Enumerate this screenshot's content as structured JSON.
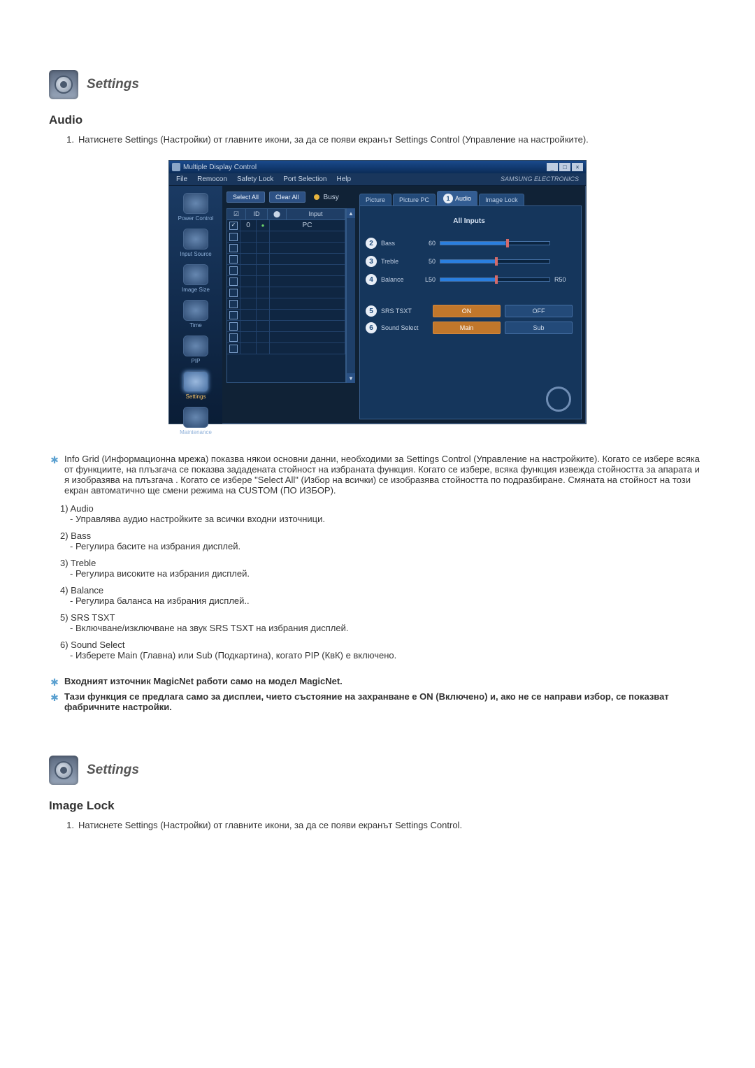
{
  "section1": {
    "title": "Settings",
    "subtitle": "Audio",
    "step_n": "1.",
    "step_text": "Натиснете Settings (Настройки) от главните икони, за да се появи екранът Settings Control (Управление на настройките)."
  },
  "app": {
    "title": "Multiple Display Control",
    "menu": [
      "File",
      "Remocon",
      "Safety Lock",
      "Port Selection",
      "Help"
    ],
    "brand": "SAMSUNG ELECTRONICS",
    "side": [
      {
        "label": "Power Control",
        "sel": false
      },
      {
        "label": "Input Source",
        "sel": false
      },
      {
        "label": "Image Size",
        "sel": false
      },
      {
        "label": "Time",
        "sel": false
      },
      {
        "label": "PIP",
        "sel": false
      },
      {
        "label": "Settings",
        "sel": true
      },
      {
        "label": "Maintenance",
        "sel": false
      }
    ],
    "grid": {
      "select_all": "Select All",
      "clear_all": "Clear All",
      "busy": "Busy",
      "headers": {
        "chk": "☑",
        "id": "ID",
        "st": "⬤",
        "input": "Input"
      },
      "rows": [
        {
          "chk": true,
          "id": "0",
          "st": "●",
          "input": "PC"
        },
        {
          "chk": false,
          "id": "",
          "st": "",
          "input": ""
        },
        {
          "chk": false,
          "id": "",
          "st": "",
          "input": ""
        },
        {
          "chk": false,
          "id": "",
          "st": "",
          "input": ""
        },
        {
          "chk": false,
          "id": "",
          "st": "",
          "input": ""
        },
        {
          "chk": false,
          "id": "",
          "st": "",
          "input": ""
        },
        {
          "chk": false,
          "id": "",
          "st": "",
          "input": ""
        },
        {
          "chk": false,
          "id": "",
          "st": "",
          "input": ""
        },
        {
          "chk": false,
          "id": "",
          "st": "",
          "input": ""
        },
        {
          "chk": false,
          "id": "",
          "st": "",
          "input": ""
        },
        {
          "chk": false,
          "id": "",
          "st": "",
          "input": ""
        },
        {
          "chk": false,
          "id": "",
          "st": "",
          "input": ""
        }
      ]
    },
    "tabs": [
      "Picture",
      "Picture PC",
      "Audio",
      "Image Lock"
    ],
    "tab_badge": "1",
    "panel": {
      "header": "All Inputs",
      "sliders": [
        {
          "n": "2",
          "label": "Bass",
          "val": "60",
          "p": "60%",
          "rv": ""
        },
        {
          "n": "3",
          "label": "Treble",
          "val": "50",
          "p": "50%",
          "rv": ""
        },
        {
          "n": "4",
          "label": "Balance",
          "val": "L50",
          "p": "50%",
          "rv": "R50"
        }
      ],
      "btns": [
        {
          "n": "5",
          "label": "SRS TSXT",
          "a": "ON",
          "b": "OFF",
          "on": "a"
        },
        {
          "n": "6",
          "label": "Sound Select",
          "a": "Main",
          "b": "Sub",
          "on": "a"
        }
      ]
    }
  },
  "notes": {
    "info_grid": "Info Grid (Информационна мрежа) показва някои основни данни, необходими за Settings Control (Управление на настройките). Когато се избере всяка от функциите, на плъзгача се показва зададената стойност на избраната функция. Когато се избере, всяка функция извежда стойността за апарата и я изобразява на плъзгача . Когато се избере \"Select All\" (Избор на всички) се изобразява стойността по подразбиране. Смяната на стойност на този екран автоматично ще смени режима на CUSTOM (ПО ИЗБОР)."
  },
  "defs": [
    {
      "n": "1)",
      "title": "Audio",
      "desc": "- Управлява аудио настройките за всички входни източници."
    },
    {
      "n": "2)",
      "title": "Bass",
      "desc": "- Регулира басите на избрания дисплей."
    },
    {
      "n": "3)",
      "title": "Treble",
      "desc": "- Регулира високите на избрания дисплей."
    },
    {
      "n": "4)",
      "title": "Balance",
      "desc": "- Регулира баланса на избрания дисплей.."
    },
    {
      "n": "5)",
      "title": "SRS TSXT",
      "desc": "- Включване/изключване на звук SRS TSXT на избрания дисплей."
    },
    {
      "n": "6)",
      "title": "Sound Select",
      "desc": "- Изберете Main (Главна) или Sub (Подкартина), когато PIP (КвК) е включено."
    }
  ],
  "foot_notes": [
    "Входният източник MagicNet работи само на модел MagicNet.",
    "Тази функция се предлага само за дисплеи, чието състояние на захранване е ON (Включено) и, ако не се направи избор, се показват фабричните настройки."
  ],
  "section2": {
    "title": "Settings",
    "subtitle": "Image Lock",
    "step_n": "1.",
    "step_text": "Натиснете Settings (Настройки) от главните икони, за да се появи екранът Settings Control."
  }
}
